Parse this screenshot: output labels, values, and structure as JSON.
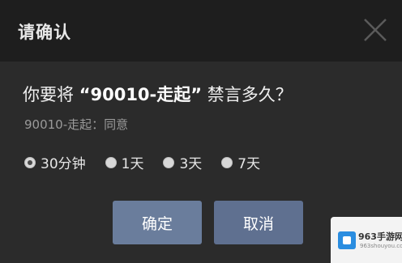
{
  "dialog": {
    "title": "请确认",
    "close_icon": "close-icon",
    "question_prefix": "你要将 ",
    "question_target": "“90010-走起”",
    "question_suffix": " 禁言多久？",
    "sub_text": "90010-走起：同意",
    "options": [
      {
        "label": "30分钟",
        "checked": true
      },
      {
        "label": "1天",
        "checked": false
      },
      {
        "label": "3天",
        "checked": false
      },
      {
        "label": "7天",
        "checked": false
      }
    ],
    "ok_label": "确定",
    "cancel_label": "取消"
  },
  "watermark": {
    "text": "963手游网",
    "sub": "963shouyou.com"
  },
  "colors": {
    "titlebar_bg": "#1e1e1e",
    "body_bg": "#2b2b2b",
    "button_bg": "#6a7d9c"
  }
}
